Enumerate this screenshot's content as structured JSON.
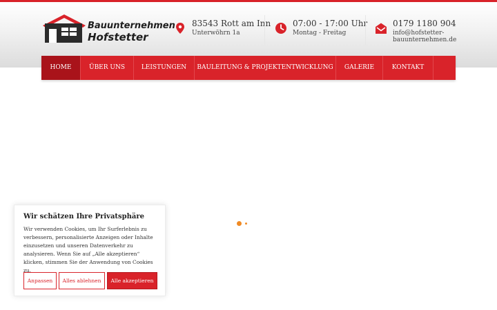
{
  "brand": {
    "name_line1": "Bauunternehmen",
    "name_line2": "Hofstetter",
    "accent": "#d9232a",
    "dark": "#2b2b2b"
  },
  "header": {
    "address": {
      "icon": "location-pin-icon",
      "line1": "83543 Rott am Inn",
      "line2": "Unterwöhrn 1a"
    },
    "hours": {
      "icon": "clock-icon",
      "line1": "07:00 - 17:00 Uhr",
      "line2": "Montag - Freitag"
    },
    "contact": {
      "icon": "envelope-icon",
      "line1": "0179 1180 904",
      "line2": "info@hofstetter-",
      "line3": "bauunternehmen.de"
    }
  },
  "nav": {
    "items": [
      {
        "label": "Home",
        "active": true
      },
      {
        "label": "Über uns",
        "active": false
      },
      {
        "label": "Leistungen",
        "active": false
      },
      {
        "label": "Bauleitung & Projektentwicklung",
        "active": false
      },
      {
        "label": "Galerie",
        "active": false
      },
      {
        "label": "Kontakt",
        "active": false
      }
    ]
  },
  "loader": {
    "color": "#f08a24"
  },
  "cookie_banner": {
    "title": "Wir schätzen Ihre Privatsphäre",
    "text": "Wir verwenden Cookies, um Ihr Surferlebnis zu verbessern, personalisierte Anzeigen oder Inhalte einzusetzen und unseren Datenverkehr zu analysieren. Wenn Sie auf „Alle akzeptieren“ klicken, stimmen Sie der Anwendung von Cookies zu.",
    "customize_label": "Anpassen",
    "reject_label": "Alles ablehnen",
    "accept_label": "Alle akzeptieren"
  }
}
